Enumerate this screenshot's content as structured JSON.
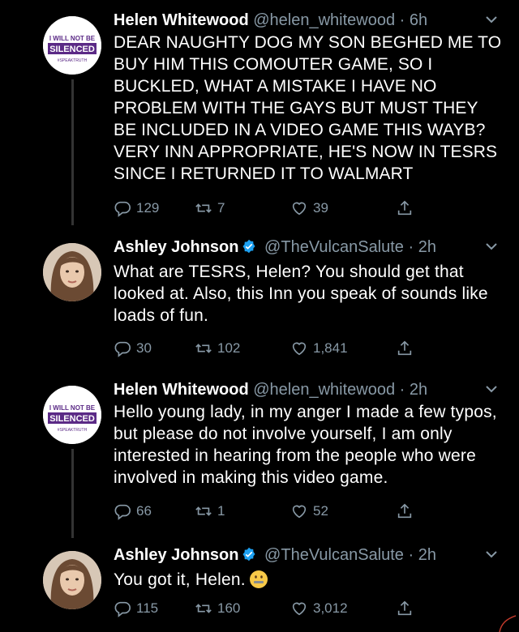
{
  "colors": {
    "background": "#000000",
    "text": "#ffffff",
    "muted": "#8899a6",
    "verified": "#1da1f2",
    "helen_purple": "#5b2a86"
  },
  "helen_avatar_text": {
    "line1": "I WILL NOT BE",
    "line2": "SILENCED",
    "line3": "#SPEAKTRUTH"
  },
  "tweets": [
    {
      "name": "Helen Whitewood",
      "handle": "@helen_whitewood · 6h",
      "text": "DEAR NAUGHTY DOG MY SON BEGHED ME TO BUY HIM THIS COMOUTER GAME, SO I BUCKLED, WHAT A MISTAKE I HAVE NO PROBLEM WITH THE GAYS BUT MUST THEY BE INCLUDED IN A VIDEO GAME THIS WAYB? VERY INN APPROPRIATE, HE'S NOW IN TESRS SINCE I RETURNED IT TO WALMART",
      "replies": "129",
      "retweets": "7",
      "likes": "39"
    },
    {
      "name": "Ashley Johnson",
      "handle": "@TheVulcanSalute · 2h",
      "text": "What are TESRS, Helen? You should get that looked at. Also, this Inn you speak of sounds like loads of fun.",
      "replies": "30",
      "retweets": "102",
      "likes": "1,841"
    },
    {
      "name": "Helen Whitewood",
      "handle": "@helen_whitewood · 2h",
      "text": "Hello young lady, in my anger I made a few typos, but please do not involve yourself, I am only interested in hearing from the people who were involved in making this video game.",
      "replies": "66",
      "retweets": "1",
      "likes": "52"
    },
    {
      "name": "Ashley Johnson",
      "handle": "@TheVulcanSalute · 2h",
      "text": "You got it, Helen.",
      "emoji": "zipper-mouth-face-icon",
      "replies": "115",
      "retweets": "160",
      "likes": "3,012"
    }
  ]
}
